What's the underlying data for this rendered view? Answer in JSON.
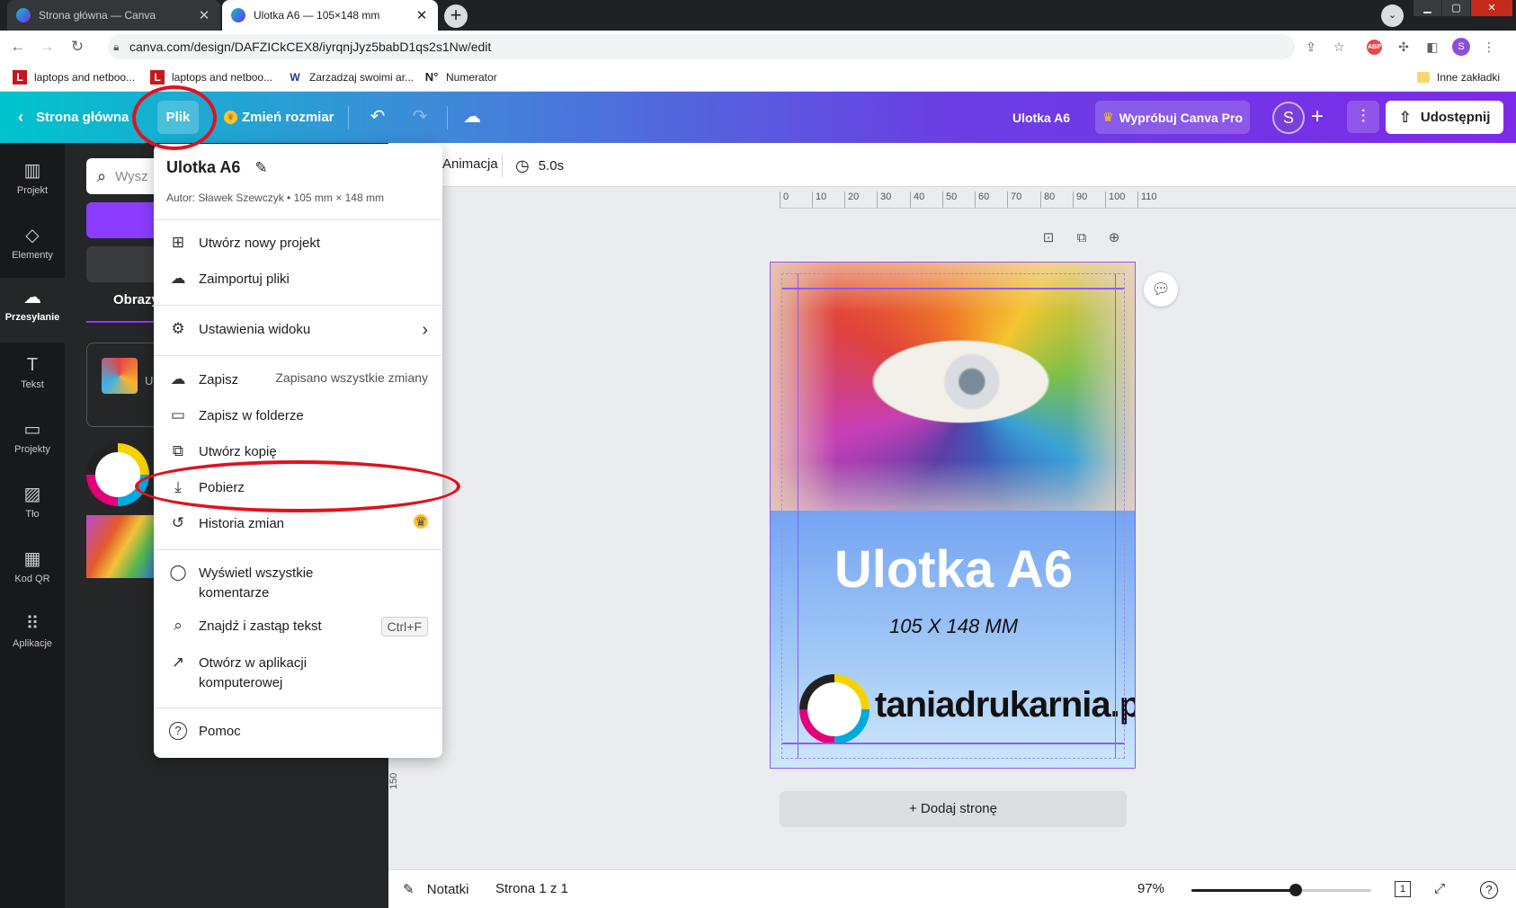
{
  "browser": {
    "tabs": [
      {
        "label": "Strona główna — Canva",
        "close": "✕"
      },
      {
        "label": "Ulotka A6 — 105×148 mm",
        "close": "✕"
      }
    ],
    "new_tab": "+",
    "url": "canva.com/design/DAFZICkCEX8/iyrqnjJyz5babD1qs2s1Nw/edit",
    "profile_initial": "S",
    "bookmarks": [
      {
        "label": "laptops and netboo...",
        "icon": "L"
      },
      {
        "label": "laptops and netboo...",
        "icon": "L"
      },
      {
        "label": "Zarzadzaj swoimi ar...",
        "icon": "W"
      },
      {
        "label": "Numerator",
        "icon": "N°"
      }
    ],
    "other_bookmarks": "Inne zakładki"
  },
  "header": {
    "home": "Strona główna",
    "file": "Plik",
    "resize": "Zmień rozmiar",
    "doc_title": "Ulotka A6",
    "try_pro": "Wypróbuj Canva Pro",
    "avatar_initial": "S",
    "share": "Udostępnij"
  },
  "siderail": [
    {
      "label": "Projekt",
      "icon": "▥"
    },
    {
      "label": "Elementy",
      "icon": "◇"
    },
    {
      "label": "Przesyłanie",
      "icon": "☁"
    },
    {
      "label": "Tekst",
      "icon": "T"
    },
    {
      "label": "Projekty",
      "icon": "▭"
    },
    {
      "label": "Tło",
      "icon": "▨"
    },
    {
      "label": "Kod QR",
      "icon": "▦"
    },
    {
      "label": "Aplikacje",
      "icon": "⠿"
    }
  ],
  "panel": {
    "search_placeholder": "Wysz",
    "tab": "Obrazy",
    "card_text": "U\nC"
  },
  "toolbar": {
    "animation": "Animacja",
    "duration": "5.0s"
  },
  "ruler": [
    "0",
    "10",
    "20",
    "30",
    "40",
    "50",
    "60",
    "70",
    "80",
    "90",
    "100",
    "110"
  ],
  "vruler": "150",
  "design": {
    "title": "Ulotka A6",
    "subtitle": "105 X 148 MM",
    "brand": "taniadrukarnia.pl"
  },
  "add_page": "+ Dodaj stronę",
  "bottom": {
    "notes": "Notatki",
    "page": "Strona 1 z 1",
    "zoom": "97%",
    "zoom_value": 0.58,
    "page_count": "1",
    "help": "?"
  },
  "menu": {
    "title": "Ulotka A6",
    "author": "Autor: Sławek Szewczyk • 105 mm × 148 mm",
    "items": [
      {
        "label": "Utwórz nowy projekt",
        "icon": "⊞"
      },
      {
        "label": "Zaimportuj pliki",
        "icon": "☁"
      },
      {
        "label": "Ustawienia widoku",
        "icon": "⚙",
        "right": "›"
      },
      {
        "label": "Zapisz",
        "icon": "☁",
        "right": "Zapisano wszystkie zmiany"
      },
      {
        "label": "Zapisz w folderze",
        "icon": "▭"
      },
      {
        "label": "Utwórz kopię",
        "icon": "⧉"
      },
      {
        "label": "Pobierz",
        "icon": "⤓"
      },
      {
        "label": "Historia zmian",
        "icon": "↺"
      },
      {
        "label": "Wyświetl wszystkie komentarze",
        "icon": "◯"
      },
      {
        "label": "Znajdź i zastąp tekst",
        "icon": "⌕",
        "right": "Ctrl+F"
      },
      {
        "label": "Otwórz w aplikacji komputerowej",
        "icon": "↗"
      },
      {
        "label": "Pomoc",
        "icon": "?"
      }
    ]
  }
}
